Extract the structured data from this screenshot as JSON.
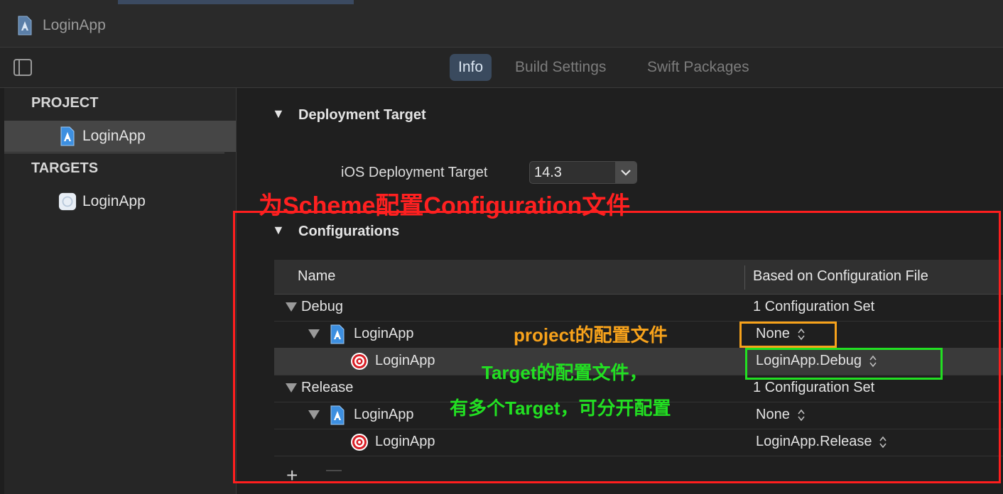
{
  "window": {
    "title": "LoginApp"
  },
  "tabs": {
    "info": "Info",
    "build_settings": "Build Settings",
    "swift_packages": "Swift Packages"
  },
  "sidebar": {
    "project_header": "PROJECT",
    "project_item": "LoginApp",
    "targets_header": "TARGETS",
    "target_item": "LoginApp"
  },
  "deployment": {
    "title": "Deployment Target",
    "label": "iOS Deployment Target",
    "value": "14.3"
  },
  "configurations": {
    "title": "Configurations",
    "columns": {
      "name": "Name",
      "file": "Based on Configuration File"
    },
    "rows": [
      {
        "name": "Debug",
        "file": "1 Configuration Set"
      },
      {
        "name": "LoginApp",
        "file": "None"
      },
      {
        "name": "LoginApp",
        "file": "LoginApp.Debug"
      },
      {
        "name": "Release",
        "file": "1 Configuration Set"
      },
      {
        "name": "LoginApp",
        "file": "None"
      },
      {
        "name": "LoginApp",
        "file": "LoginApp.Release"
      }
    ],
    "add_label": "+"
  },
  "annotations": {
    "scheme": "为Scheme配置Configuration文件",
    "project_file": "project的配置文件",
    "target_file_line1": "Target的配置文件，",
    "target_file_line2": "有多个Target，可分开配置"
  },
  "colors": {
    "accent_tab": "#3a4a5e",
    "annotation_red": "#ff1e1e",
    "annotation_orange": "#f7a21b",
    "annotation_green": "#22e022"
  }
}
